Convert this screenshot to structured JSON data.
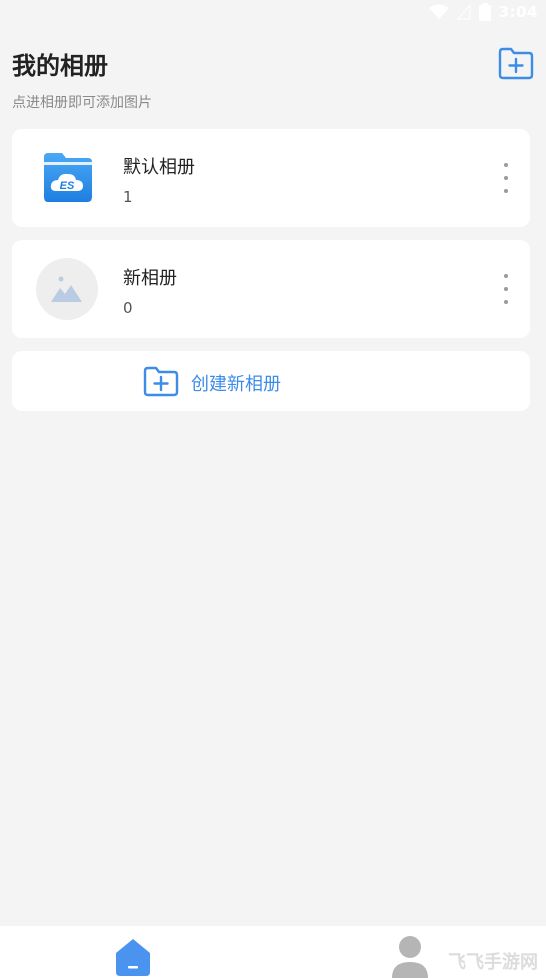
{
  "status_bar": {
    "time": "3:04"
  },
  "header": {
    "title": "我的相册",
    "subtitle": "点进相册即可添加图片"
  },
  "albums": [
    {
      "name": "默认相册",
      "count": "1",
      "thumb": "es-folder-app-icon"
    },
    {
      "name": "新相册",
      "count": "0",
      "thumb": "image-placeholder-icon"
    }
  ],
  "create_album": {
    "label": "创建新相册"
  },
  "bottom_nav": {
    "watermark": "飞飞手游网"
  },
  "colors": {
    "accent": "#3d8ce8",
    "background": "#f4f4f4",
    "card": "#ffffff"
  }
}
